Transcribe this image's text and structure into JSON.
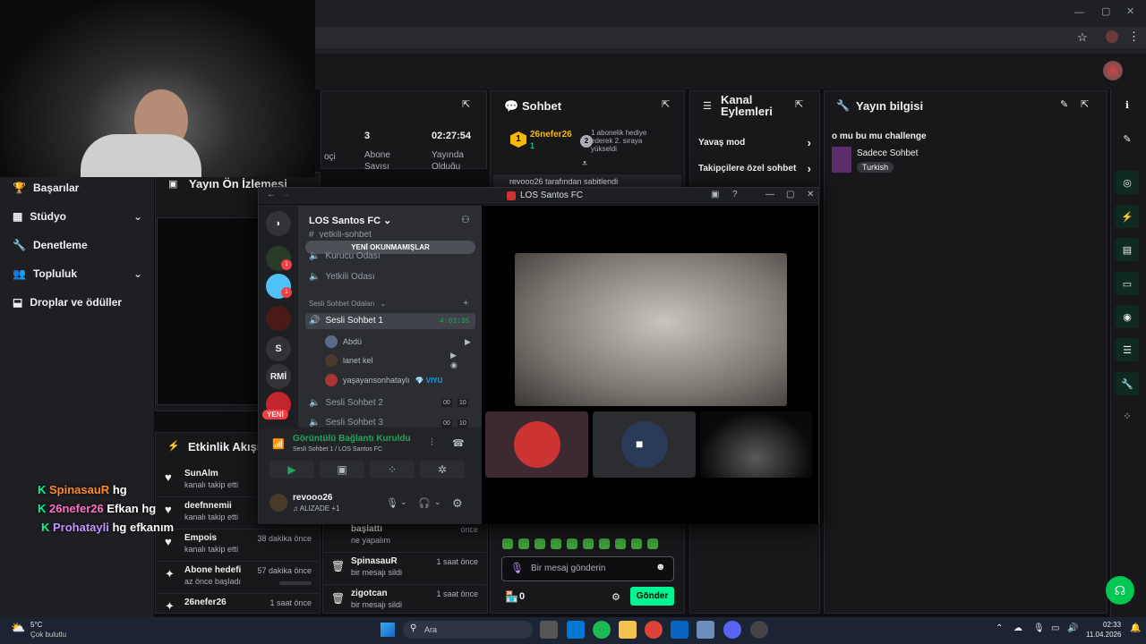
{
  "browser": {
    "profile": "avatar"
  },
  "webcam": {
    "label": "streamer webcam"
  },
  "left_nav": {
    "items": [
      {
        "label": "Başarılar",
        "icon": "trophy-icon"
      },
      {
        "label": "Stüdyo",
        "icon": "studio-icon",
        "chevron": true
      },
      {
        "label": "Denetleme",
        "icon": "wrench-icon"
      },
      {
        "label": "Topluluk",
        "icon": "community-icon",
        "chevron": true
      },
      {
        "label": "Droplar ve ödüller",
        "icon": "drops-icon"
      }
    ]
  },
  "stats": {
    "col1": "oçi",
    "col2_value": "3",
    "col2_label": "Abone",
    "col2_sub": "Sayısı",
    "col3_value": "02:27:54",
    "col3_label": "Yayında",
    "col3_sub": "Olduğu"
  },
  "preview": {
    "title": "Yayın Ön İzlemesi"
  },
  "chat": {
    "title": "Sohbet",
    "hype_user": "26nefer26",
    "hype_rank": "1",
    "hype_count": "1",
    "hype_text": "1 abonelik hediye ederek 2. sıraya yükseldi",
    "pinned_text": "revooo26 tarafından sabitlendi",
    "emotes": 12,
    "input_placeholder": "Bir mesaj gönderin",
    "points": "0",
    "send": "Gönder"
  },
  "actions": {
    "title": "Kanal Eylemleri",
    "slow_mode": "Yavaş mod",
    "followers_only": "Takipçilere özel sohbet"
  },
  "info": {
    "title": "Yayın bilgisi",
    "stream_title": "o mu bu mu challenge",
    "category": "Sadece Sohbet",
    "tag": "Turkish"
  },
  "activity": {
    "title": "Etkinlik Akışı",
    "items": [
      {
        "user": "SunAlm",
        "detail": "kanalı takip etti",
        "time": ""
      },
      {
        "user": "deefnnemii",
        "detail": "kanalı takip etti",
        "time": ""
      },
      {
        "user": "Empois",
        "detail": "kanalı takip etti",
        "time": "38 dakika önce"
      },
      {
        "user": "Abone hedefi",
        "detail": "az önce başladı",
        "time": "57 dakika önce"
      },
      {
        "user": "26nefer26",
        "detail": "",
        "time": "1 saat önce"
      }
    ]
  },
  "modlog": {
    "items": [
      {
        "user": "başlattı",
        "detail": "ne yapalım",
        "time": "önce"
      },
      {
        "user": "SpinasauR",
        "detail": "bir mesajı sildi",
        "time": "1 saat önce"
      },
      {
        "user": "zigotcan",
        "detail": "bir mesajı sildi",
        "time": "1 saat önce"
      }
    ]
  },
  "overlay_chat": [
    {
      "user": "SpinasauR",
      "msg": "hg",
      "color": "#ff8b2a"
    },
    {
      "user": "26nefer26",
      "msg": "Efkan hg",
      "color": "#ff6ec7"
    },
    {
      "user": "Prohatayli",
      "msg": "hg efkanım",
      "color": "#bf94ff"
    }
  ],
  "discord": {
    "window_title": "LOS Santos FC",
    "server_name": "LOS Santos FC",
    "unread_pill": "YENİ OKUNMAMIŞLAR",
    "channel_top": "yetkili-sohbet",
    "channels": [
      "Kurucu Odası",
      "Yetkili Odası"
    ],
    "category": "Sesli Sohbet Odaları",
    "voice1": "Sesli Sohbet 1",
    "voice1_time": "4:03:35",
    "users": [
      "Abdü",
      "lanet kel",
      "yaşayansonhataylı"
    ],
    "user3_badge": "VIYU",
    "voice2": "Sesli Sohbet 2",
    "voice3": "Sesli Sohbet 3",
    "vc_counts": [
      "00",
      "10"
    ],
    "servers": [
      "S",
      "RMİ"
    ],
    "badge1": "1",
    "badge2": "1",
    "new_label": "YENİ",
    "conn_status": "Görüntülü Bağlantı Kuruldu",
    "conn_sub": "Sesli Sohbet 1 / LOS Santos FC",
    "me": "revooo26",
    "me_status": "ALIZADE +1"
  },
  "taskbar": {
    "weather_temp": "5°C",
    "weather_desc": "Çok bulutlu",
    "search": "Ara",
    "time": "02:33",
    "date": "11.04.2026"
  },
  "colors": {
    "twitch_green": "#00f593",
    "discord_green": "#23a55a",
    "accent_purple": "#9147ff"
  }
}
